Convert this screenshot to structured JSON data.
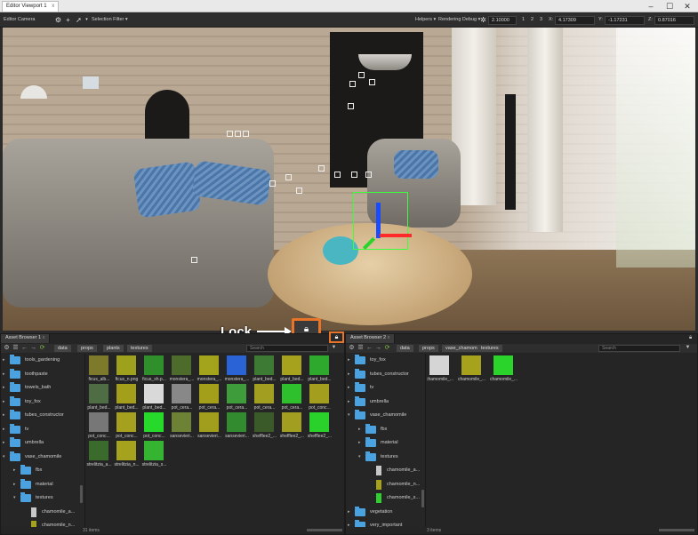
{
  "window": {
    "tab": "Editor Viewport 1",
    "tab_close": "x"
  },
  "viewport_toolbar": {
    "camera": "Editor Camera",
    "selection_filter": "Selection Filter",
    "helpers": "Helpers",
    "rendering_debug": "Rendering Debug",
    "speed": "2.10000",
    "pages": [
      "1",
      "2",
      "3"
    ],
    "x_label": "X:",
    "x_value": "4.17309",
    "y_label": "Y:",
    "y_value": "-1.17231",
    "z_label": "Z:",
    "z_value": "0.87016"
  },
  "callout": {
    "label": "Lock"
  },
  "asset_browser_1": {
    "tab": "Asset Browser 1",
    "breadcrumb": [
      "data",
      "props",
      "plants",
      "textures"
    ],
    "search_placeholder": "Search",
    "tree": [
      {
        "label": "tools_gardening",
        "level": 1,
        "expanded": false
      },
      {
        "label": "toothpaste",
        "level": 1,
        "expanded": false
      },
      {
        "label": "towels_bath",
        "level": 1,
        "expanded": false
      },
      {
        "label": "toy_fox",
        "level": 1,
        "expanded": false
      },
      {
        "label": "tubes_constructor",
        "level": 1,
        "expanded": false
      },
      {
        "label": "tv",
        "level": 1,
        "expanded": false
      },
      {
        "label": "umbrella",
        "level": 1,
        "expanded": false
      },
      {
        "label": "vase_chamomile",
        "level": 1,
        "expanded": true
      },
      {
        "label": "fbx",
        "level": 2,
        "expanded": false
      },
      {
        "label": "material",
        "level": 2,
        "expanded": false
      },
      {
        "label": "textures",
        "level": 2,
        "expanded": true
      },
      {
        "label": "chamomile_a...",
        "level": 3,
        "file": true,
        "color": "#c8c8c8"
      },
      {
        "label": "chamomile_n...",
        "level": 3,
        "file": true,
        "color": "#a7a21a"
      }
    ],
    "assets": [
      {
        "label": "ficus_alb...",
        "color": "#7e7a2c"
      },
      {
        "label": "ficus_n.png",
        "color": "#9ea11b"
      },
      {
        "label": "ficus_sh.p...",
        "color": "#2f8f2a"
      },
      {
        "label": "monstera_...",
        "color": "#4d6b2a"
      },
      {
        "label": "monstera_...",
        "color": "#a4a31c"
      },
      {
        "label": "monstera_...",
        "color": "#2a63d6"
      },
      {
        "label": "plant_bed...",
        "color": "#3d7a34"
      },
      {
        "label": "plant_bed...",
        "color": "#a6a21d"
      },
      {
        "label": "plant_bed...",
        "color": "#2ea82d"
      },
      {
        "label": "plant_bed...",
        "color": "#4f6d44"
      },
      {
        "label": "plant_bed...",
        "color": "#a39f1b"
      },
      {
        "label": "plant_bed...",
        "color": "#d9d9d9"
      },
      {
        "label": "pot_cera...",
        "color": "#888888"
      },
      {
        "label": "pot_cera...",
        "color": "#a49f1b"
      },
      {
        "label": "pot_cera...",
        "color": "#3f9c3b"
      },
      {
        "label": "pot_cera...",
        "color": "#a29f20"
      },
      {
        "label": "pot_cera...",
        "color": "#2ec02d"
      },
      {
        "label": "pot_conc...",
        "color": "#a39e1e"
      },
      {
        "label": "pot_conc...",
        "color": "#777777"
      },
      {
        "label": "pot_conc...",
        "color": "#a5a11e"
      },
      {
        "label": "pot_conc...",
        "color": "#27d92a"
      },
      {
        "label": "sansevieri...",
        "color": "#6d8234"
      },
      {
        "label": "sansevieri...",
        "color": "#a09e1c"
      },
      {
        "label": "sansevieri...",
        "color": "#338b2f"
      },
      {
        "label": "shefflee2_...",
        "color": "#3a5a2a"
      },
      {
        "label": "shefflee2_...",
        "color": "#a29f20"
      },
      {
        "label": "shefflee2_...",
        "color": "#2bd12b"
      },
      {
        "label": "strelitzia_a...",
        "color": "#3b6b2c"
      },
      {
        "label": "strelitzia_n...",
        "color": "#a5a31d"
      },
      {
        "label": "strelitzia_s...",
        "color": "#34b431"
      }
    ],
    "status": "31 items"
  },
  "asset_browser_2": {
    "tab": "Asset Browser 2",
    "breadcrumb": [
      "data",
      "props",
      "vase_chamomile",
      "textures"
    ],
    "search_placeholder": "Search",
    "tree": [
      {
        "label": "toy_fox",
        "level": 1,
        "expanded": false
      },
      {
        "label": "tubes_constructor",
        "level": 1,
        "expanded": false
      },
      {
        "label": "tv",
        "level": 1,
        "expanded": false
      },
      {
        "label": "umbrella",
        "level": 1,
        "expanded": false
      },
      {
        "label": "vase_chamomile",
        "level": 1,
        "expanded": true
      },
      {
        "label": "fbx",
        "level": 2,
        "expanded": false
      },
      {
        "label": "material",
        "level": 2,
        "expanded": false
      },
      {
        "label": "textures",
        "level": 2,
        "expanded": true
      },
      {
        "label": "chamomile_a...",
        "level": 3,
        "file": true,
        "color": "#c8c8c8"
      },
      {
        "label": "chamomile_n...",
        "level": 3,
        "file": true,
        "color": "#a7a21a"
      },
      {
        "label": "chamomile_s...",
        "level": 3,
        "file": true,
        "color": "#2fcf2f"
      },
      {
        "label": "vegetation",
        "level": 1,
        "expanded": false
      },
      {
        "label": "very_important",
        "level": 1,
        "expanded": false
      }
    ],
    "assets": [
      {
        "label": "chamomile_...",
        "color": "#d5d5d5"
      },
      {
        "label": "chamomile_...",
        "color": "#a6a21c"
      },
      {
        "label": "chamomile_...",
        "color": "#2bd42b"
      }
    ],
    "status": "3 items"
  }
}
